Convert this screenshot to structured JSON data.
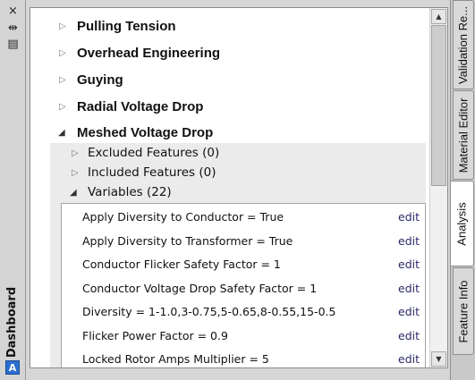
{
  "left_strip": {
    "close_icon": "×",
    "pin_icon": "⇹",
    "properties_icon": "▤",
    "title": "Dashboard",
    "logo": "A"
  },
  "sections": [
    {
      "label": "Pulling Tension",
      "expanded": false
    },
    {
      "label": "Overhead Engineering",
      "expanded": false
    },
    {
      "label": "Guying",
      "expanded": false
    },
    {
      "label": "Radial Voltage Drop",
      "expanded": false
    },
    {
      "label": "Meshed Voltage Drop",
      "expanded": true
    }
  ],
  "subsections": [
    {
      "label": "Excluded Features (0)",
      "expanded": false
    },
    {
      "label": "Included Features (0)",
      "expanded": false
    },
    {
      "label": "Variables (22)",
      "expanded": true
    }
  ],
  "variables": [
    {
      "label": "Apply Diversity to Conductor = True",
      "action": "edit"
    },
    {
      "label": "Apply Diversity to Transformer = True",
      "action": "edit"
    },
    {
      "label": "Conductor Flicker Safety Factor = 1",
      "action": "edit"
    },
    {
      "label": "Conductor Voltage Drop Safety Factor = 1",
      "action": "edit"
    },
    {
      "label": "Diversity = 1-1.0,3-0.75,5-0.65,8-0.55,15-0.5",
      "action": "edit"
    },
    {
      "label": "Flicker Power Factor = 0.9",
      "action": "edit"
    },
    {
      "label": "Locked Rotor Amps Multiplier = 5",
      "action": "edit"
    }
  ],
  "tabs": [
    {
      "label": "Validation Re...",
      "active": false
    },
    {
      "label": "Material Editor",
      "active": false
    },
    {
      "label": "Analysis",
      "active": true
    },
    {
      "label": "Feature Info",
      "active": false
    }
  ],
  "scrollbar": {
    "up": "▲",
    "down": "▼"
  }
}
